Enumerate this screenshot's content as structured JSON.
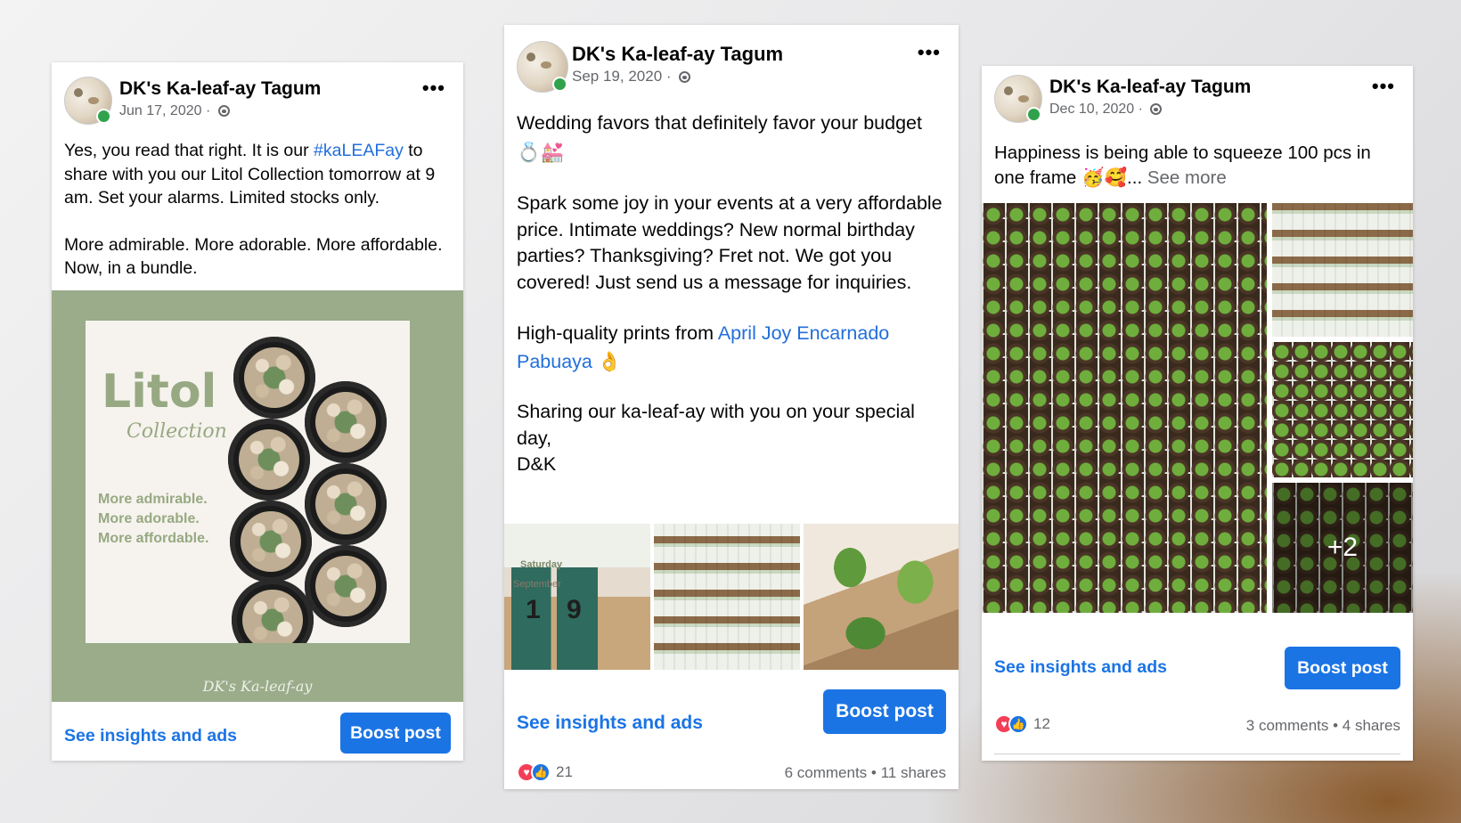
{
  "page_name": "DK's Ka-leaf-ay Tagum",
  "posts": [
    {
      "date": "Jun 17, 2020",
      "text_parts": {
        "a": "Yes, you read that right. It is our ",
        "hashtag": "#kaLEAFay",
        "b": " to share with you our Litol Collection tomorrow at 9 am. Set your alarms. Limited stocks only.",
        "p2": "More admirable. More adorable. More affordable. Now, in a bundle."
      },
      "image": {
        "title": "Litol",
        "subtitle": "Collection",
        "taglines": [
          "More admirable.",
          "More adorable.",
          "More affordable."
        ],
        "brand": "DK's Ka-leaf-ay"
      },
      "insights_label": "See insights and ads",
      "boost_label": "Boost post"
    },
    {
      "date": "Sep 19, 2020",
      "text_parts": {
        "p1": "Wedding favors that definitely favor your budget 💍💒",
        "p2": "Spark some joy in your events at a very affordable price. Intimate weddings? New normal birthday parties? Thanksgiving? Fret not. We got you covered! Just send us a message for inquiries.",
        "p3_a": "High-quality prints from ",
        "p3_link": "April Joy Encarnado Pabuaya",
        "p3_b": " 👌",
        "p4_a": "Sharing our ka-leaf-ay with you on your special day,",
        "p4_b": "D&K"
      },
      "photo_labels": {
        "day": "Saturday",
        "month": "September",
        "d1": "1",
        "d2": "9"
      },
      "insights_label": "See insights and ads",
      "boost_label": "Boost post",
      "reaction_count": "21",
      "comments": "6 comments",
      "shares": "11 shares"
    },
    {
      "date": "Dec 10, 2020",
      "text_parts": {
        "a": "Happiness is being able to squeeze 100 pcs in one frame 🥳🥰",
        "ellipsis": "... ",
        "see_more": "See more"
      },
      "more_photos": "+2",
      "insights_label": "See insights and ads",
      "boost_label": "Boost post",
      "reaction_count": "12",
      "comments": "3 comments",
      "shares": "4 shares"
    }
  ],
  "dot_separator": " · ",
  "bullet": " • ",
  "icons": {
    "more": "more-horiz-icon",
    "privacy": "globe-icon",
    "love": "love-reaction-icon",
    "like": "like-reaction-icon"
  },
  "colors": {
    "link": "#216fdb",
    "boost": "#1b74e4",
    "online": "#31a24c",
    "love": "#f33e58",
    "sage": "#9aac8a"
  }
}
